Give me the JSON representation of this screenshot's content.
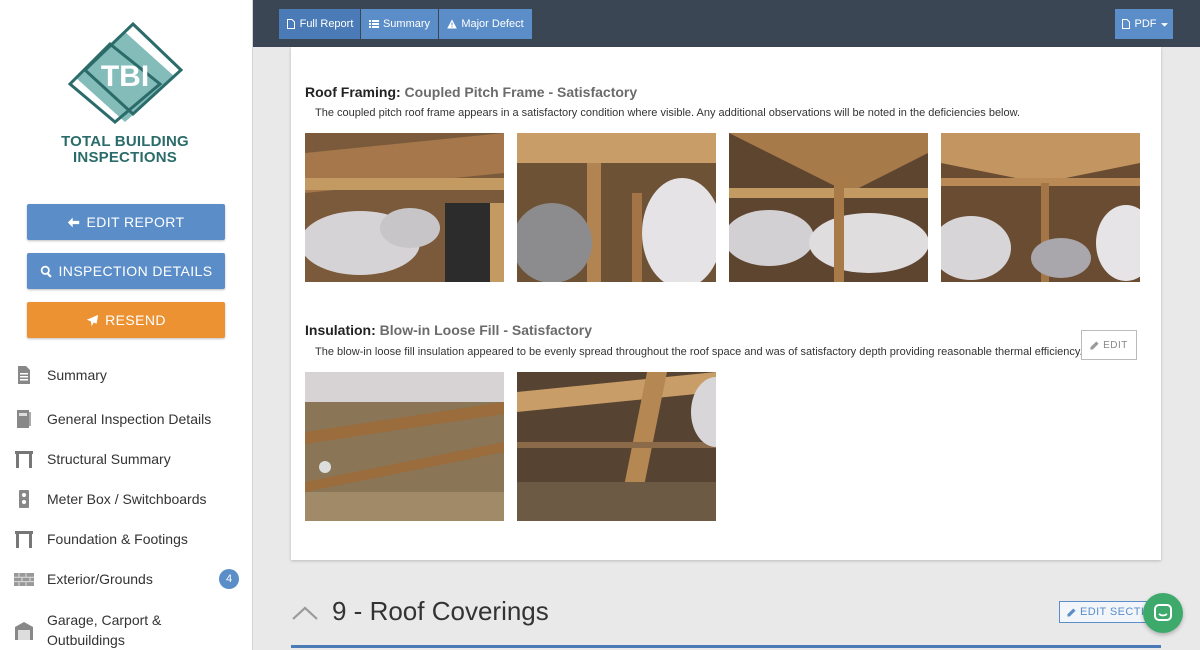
{
  "logo": {
    "initials": "TBI",
    "line1": "TOTAL BUILDING",
    "line2": "INSPECTIONS"
  },
  "sidebar": {
    "buttons": {
      "edit_report": "EDIT REPORT",
      "inspection_details": "INSPECTION DETAILS",
      "resend": "RESEND"
    },
    "items": [
      {
        "label": "Summary",
        "icon": "document-icon"
      },
      {
        "label": "General Inspection Details",
        "icon": "book-icon"
      },
      {
        "label": "Structural Summary",
        "icon": "structure-icon"
      },
      {
        "label": "Meter Box / Switchboards",
        "icon": "meter-icon"
      },
      {
        "label": "Foundation & Footings",
        "icon": "foundation-icon"
      },
      {
        "label": "Exterior/Grounds",
        "icon": "brick-icon",
        "badge": "4"
      },
      {
        "label": "Garage, Carport &",
        "label2": "Outbuildings",
        "icon": "garage-icon"
      }
    ]
  },
  "topbar": {
    "full_report": "Full Report",
    "summary": "Summary",
    "major_defect": "Major Defect",
    "pdf": "PDF"
  },
  "content": {
    "roof_framing": {
      "title": "Roof Framing:",
      "subtitle": "Coupled Pitch Frame - Satisfactory",
      "description": "The coupled pitch roof frame appears in a satisfactory condition where visible. Any additional observations will be noted in the deficiencies below."
    },
    "insulation": {
      "title": "Insulation:",
      "subtitle": "Blow-in Loose Fill - Satisfactory",
      "description": "The blow-in loose fill insulation appeared to be evenly spread throughout the roof space and was of satisfactory depth providing reasonable thermal efficiency."
    },
    "edit_label": "EDIT"
  },
  "section": {
    "title": "9 - Roof Coverings",
    "edit_label": "EDIT SECTION"
  },
  "colors": {
    "topbar": "#3a4653",
    "button_blue": "#5b8ec8",
    "resend_orange": "#ec9232",
    "brand_teal": "#2b6c6b"
  }
}
